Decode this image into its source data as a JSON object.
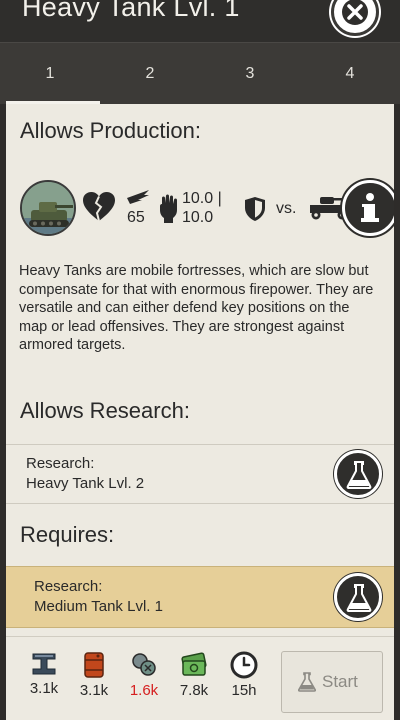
{
  "header": {
    "title": "Heavy Tank Lvl. 1",
    "close_icon": "close-icon"
  },
  "tabs": [
    {
      "label": "1",
      "active": true
    },
    {
      "label": "2",
      "active": false
    },
    {
      "label": "3",
      "active": false
    },
    {
      "label": "4",
      "active": false
    }
  ],
  "allows_production": {
    "heading": "Allows Production:",
    "unit_icon": "heavy-tank-avatar",
    "stats": {
      "speed": "65",
      "damage": "10.0 |",
      "damage_2": "10.0",
      "vs_label": "vs."
    },
    "description": "Heavy Tanks are mobile fortresses, which are slow but compensate for that with enormous firepower. They are versatile and can either defend key positions on the map or lead offensives. They are strongest against armored targets."
  },
  "allows_research": {
    "heading": "Allows Research:",
    "items": [
      {
        "kind": "Research:",
        "name": "Heavy Tank Lvl. 2"
      }
    ]
  },
  "requires": {
    "heading": "Requires:",
    "items": [
      {
        "kind": "Research:",
        "name": "Medium Tank Lvl. 1",
        "highlight_color": "#e6cf98"
      }
    ]
  },
  "costs": [
    {
      "icon": "steel-icon",
      "value": "3.1k",
      "insufficient": false
    },
    {
      "icon": "oil-barrel-icon",
      "value": "3.1k",
      "insufficient": false
    },
    {
      "icon": "rare-materials-icon",
      "value": "1.6k",
      "insufficient": true
    },
    {
      "icon": "money-icon",
      "value": "7.8k",
      "insufficient": false
    },
    {
      "icon": "clock-icon",
      "value": "15h",
      "insufficient": false
    }
  ],
  "start_button": {
    "label": "Start",
    "enabled": false
  },
  "colors": {
    "warning": "#d52020",
    "accent_gold": "#e6cf98"
  }
}
